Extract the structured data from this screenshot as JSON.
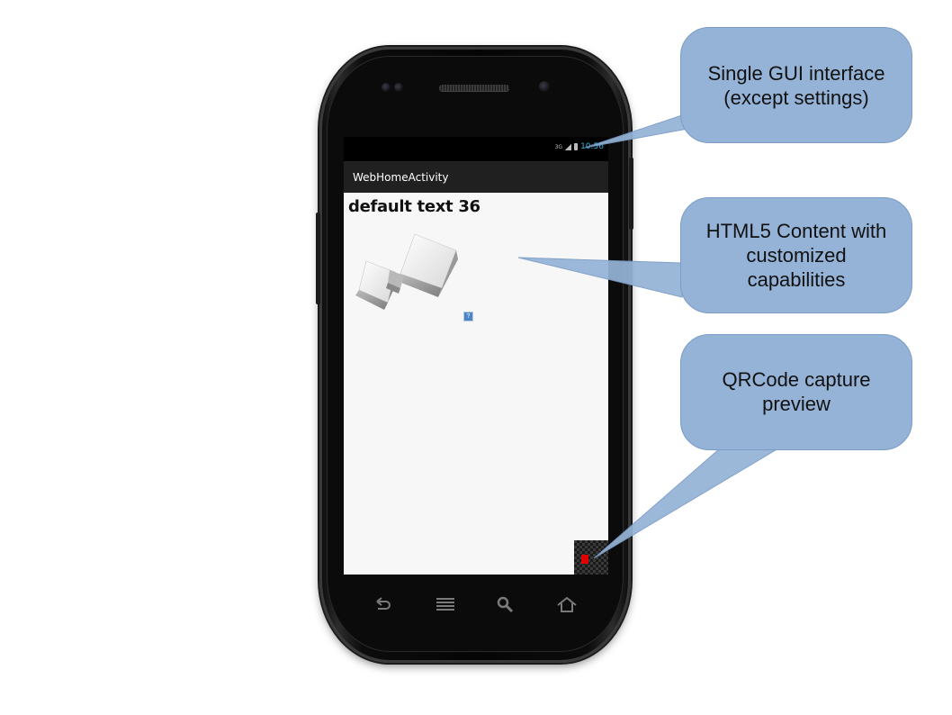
{
  "phone": {
    "status_bar": {
      "network": "3G",
      "time": "10:56"
    },
    "action_bar": {
      "title": "WebHomeActivity"
    },
    "content": {
      "text": "default text 36"
    }
  },
  "callouts": {
    "gui": {
      "line1": "Single GUI interface",
      "line2": "(except settings)"
    },
    "html5": {
      "line1": "HTML5 Content with",
      "line2": "customized",
      "line3": "capabilities"
    },
    "qr": {
      "line1": "QRCode capture",
      "line2": "preview"
    }
  },
  "nav_icons": [
    "back-icon",
    "menu-icon",
    "search-icon",
    "home-icon"
  ],
  "colors": {
    "callout_fill": "#95b3d7",
    "callout_border": "#7a9cc6",
    "clock": "#33b5e5",
    "action_bar": "#202020",
    "qr_marker": "#e00000"
  }
}
